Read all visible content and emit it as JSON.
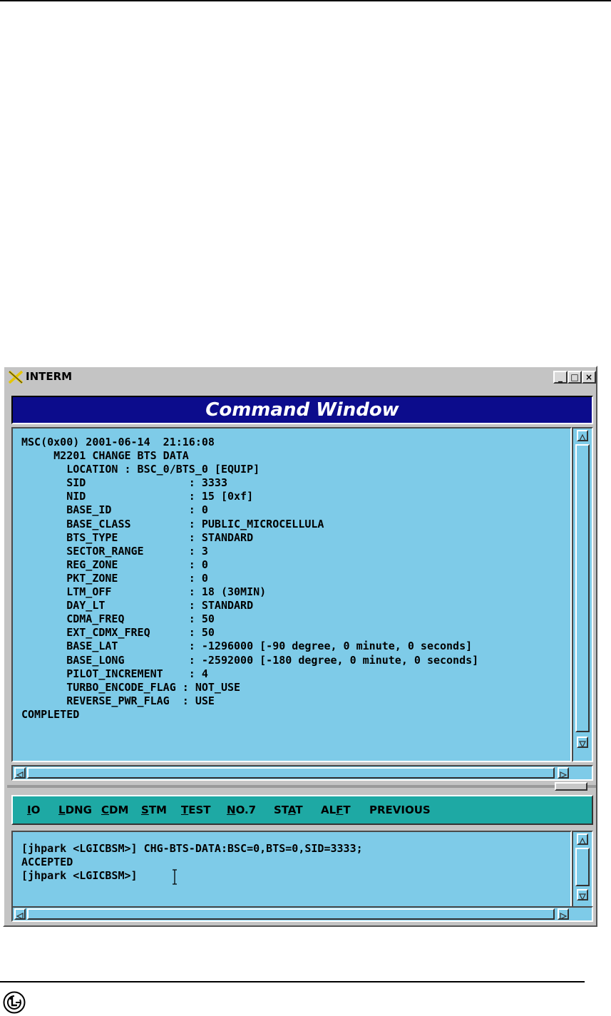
{
  "window": {
    "title": "INTERM",
    "header": "Command Window",
    "controls": {
      "minimize": "_",
      "maximize": "□",
      "close": "×"
    }
  },
  "output": {
    "lines": [
      "MSC(0x00) 2001-06-14  21:16:08",
      "     M2201 CHANGE BTS DATA",
      "       LOCATION : BSC_0/BTS_0 [EQUIP]",
      "       SID                : 3333",
      "       NID                : 15 [0xf]",
      "       BASE_ID            : 0",
      "       BASE_CLASS         : PUBLIC_MICROCELLULA",
      "       BTS_TYPE           : STANDARD",
      "       SECTOR_RANGE       : 3",
      "       REG_ZONE           : 0",
      "       PKT_ZONE           : 0",
      "       LTM_OFF            : 18 (30MIN)",
      "       DAY_LT             : STANDARD",
      "       CDMA_FREQ          : 50",
      "       EXT_CDMX_FREQ      : 50",
      "       BASE_LAT           : -1296000 [-90 degree, 0 minute, 0 seconds]",
      "       BASE_LONG          : -2592000 [-180 degree, 0 minute, 0 seconds]",
      "       PILOT_INCREMENT    : 4",
      "       TURBO_ENCODE_FLAG : NOT_USE",
      "       REVERSE_PWR_FLAG  : USE",
      "COMPLETED"
    ]
  },
  "menu": {
    "items": [
      {
        "pre": "",
        "ul": "I",
        "post": "O"
      },
      {
        "pre": "",
        "ul": "L",
        "post": "DNG"
      },
      {
        "pre": "",
        "ul": "C",
        "post": "DM"
      },
      {
        "pre": "",
        "ul": "S",
        "post": "TM"
      },
      {
        "pre": "",
        "ul": "T",
        "post": "EST"
      },
      {
        "pre": "",
        "ul": "N",
        "post": "O.7"
      },
      {
        "pre": "ST",
        "ul": "A",
        "post": "T"
      },
      {
        "pre": "AL",
        "ul": "F",
        "post": "T"
      },
      {
        "pre": "PREVIOUS",
        "ul": "",
        "post": ""
      }
    ]
  },
  "input": {
    "lines": [
      "[jhpark <LGICBSM>] CHG-BTS-DATA:BSC=0,BTS=0,SID=3333;",
      "ACCEPTED",
      "[jhpark <LGICBSM>]"
    ]
  },
  "colors": {
    "panel": "#7ecbe8",
    "header": "#0c0c8c",
    "menubar": "#1ea9a4",
    "chrome": "#c4c4c4"
  }
}
